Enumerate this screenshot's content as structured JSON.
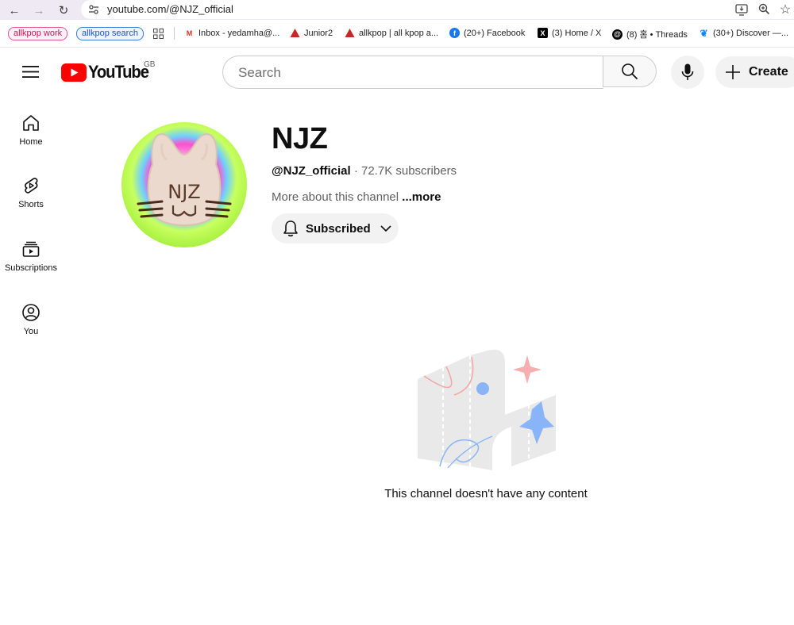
{
  "browser": {
    "url": "youtube.com/@NJZ_official",
    "bookmarks": [
      {
        "label": "allkpop work"
      },
      {
        "label": "allkpop search"
      },
      {
        "label": "Inbox - yedamha@..."
      },
      {
        "label": "Junior2"
      },
      {
        "label": "allkpop | all kpop a..."
      },
      {
        "label": "(20+) Facebook"
      },
      {
        "label": "(3) Home / X"
      },
      {
        "label": "(8) 홈 • Threads"
      },
      {
        "label": "(30+) Discover —..."
      }
    ]
  },
  "header": {
    "logo_text": "YouTube",
    "region": "GB",
    "search_placeholder": "Search",
    "create_label": "Create"
  },
  "sidebar": {
    "items": [
      {
        "label": "Home",
        "icon": "home-icon"
      },
      {
        "label": "Shorts",
        "icon": "shorts-icon"
      },
      {
        "label": "Subscriptions",
        "icon": "subscriptions-icon"
      },
      {
        "label": "You",
        "icon": "you-icon"
      }
    ]
  },
  "channel": {
    "name": "NJZ",
    "handle": "@NJZ_official",
    "separator": " · ",
    "subscribers": "72.7K subscribers",
    "about": "More about this channel",
    "more": " ...more",
    "subscribe_label": "Subscribed",
    "avatar_text": "NJZ",
    "empty_message": "This channel doesn't have any content"
  },
  "colors": {
    "brand_red": "#ff0000",
    "text": "#0f0f0f",
    "secondary_text": "#606060"
  }
}
